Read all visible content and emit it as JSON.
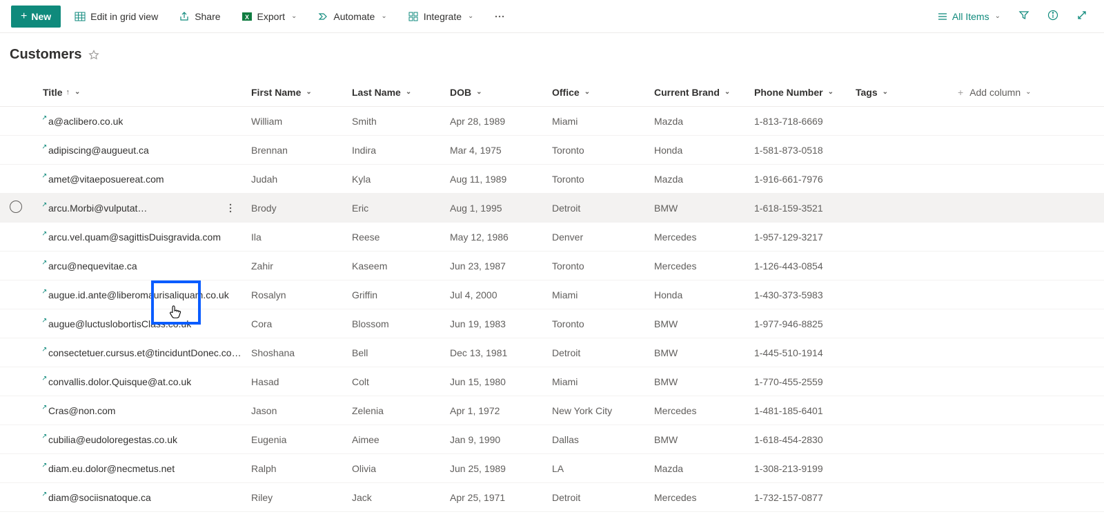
{
  "toolbar": {
    "new_label": "New",
    "edit_grid_label": "Edit in grid view",
    "share_label": "Share",
    "export_label": "Export",
    "automate_label": "Automate",
    "integrate_label": "Integrate",
    "view_label": "All Items"
  },
  "list": {
    "title": "Customers"
  },
  "columns": {
    "title": "Title",
    "first_name": "First Name",
    "last_name": "Last Name",
    "dob": "DOB",
    "office": "Office",
    "brand": "Current Brand",
    "phone": "Phone Number",
    "tags": "Tags",
    "add": "Add column"
  },
  "rows": [
    {
      "title": "a@aclibero.co.uk",
      "first": "William",
      "last": "Smith",
      "dob": "Apr 28, 1989",
      "office": "Miami",
      "brand": "Mazda",
      "phone": "1-813-718-6669"
    },
    {
      "title": "adipiscing@augueut.ca",
      "first": "Brennan",
      "last": "Indira",
      "dob": "Mar 4, 1975",
      "office": "Toronto",
      "brand": "Honda",
      "phone": "1-581-873-0518"
    },
    {
      "title": "amet@vitaeposuereat.com",
      "first": "Judah",
      "last": "Kyla",
      "dob": "Aug 11, 1989",
      "office": "Toronto",
      "brand": "Mazda",
      "phone": "1-916-661-7976"
    },
    {
      "title": "arcu.Morbi@vulputatedu...",
      "first": "Brody",
      "last": "Eric",
      "dob": "Aug 1, 1995",
      "office": "Detroit",
      "brand": "BMW",
      "phone": "1-618-159-3521",
      "hovered": true
    },
    {
      "title": "arcu.vel.quam@sagittisDuisgravida.com",
      "first": "Ila",
      "last": "Reese",
      "dob": "May 12, 1986",
      "office": "Denver",
      "brand": "Mercedes",
      "phone": "1-957-129-3217"
    },
    {
      "title": "arcu@nequevitae.ca",
      "first": "Zahir",
      "last": "Kaseem",
      "dob": "Jun 23, 1987",
      "office": "Toronto",
      "brand": "Mercedes",
      "phone": "1-126-443-0854"
    },
    {
      "title": "augue.id.ante@liberomaurisaliquam.co.uk",
      "first": "Rosalyn",
      "last": "Griffin",
      "dob": "Jul 4, 2000",
      "office": "Miami",
      "brand": "Honda",
      "phone": "1-430-373-5983"
    },
    {
      "title": "augue@luctuslobortisClass.co.uk",
      "first": "Cora",
      "last": "Blossom",
      "dob": "Jun 19, 1983",
      "office": "Toronto",
      "brand": "BMW",
      "phone": "1-977-946-8825"
    },
    {
      "title": "consectetuer.cursus.et@tinciduntDonec.co.uk",
      "first": "Shoshana",
      "last": "Bell",
      "dob": "Dec 13, 1981",
      "office": "Detroit",
      "brand": "BMW",
      "phone": "1-445-510-1914"
    },
    {
      "title": "convallis.dolor.Quisque@at.co.uk",
      "first": "Hasad",
      "last": "Colt",
      "dob": "Jun 15, 1980",
      "office": "Miami",
      "brand": "BMW",
      "phone": "1-770-455-2559"
    },
    {
      "title": "Cras@non.com",
      "first": "Jason",
      "last": "Zelenia",
      "dob": "Apr 1, 1972",
      "office": "New York City",
      "brand": "Mercedes",
      "phone": "1-481-185-6401"
    },
    {
      "title": "cubilia@eudoloregestas.co.uk",
      "first": "Eugenia",
      "last": "Aimee",
      "dob": "Jan 9, 1990",
      "office": "Dallas",
      "brand": "BMW",
      "phone": "1-618-454-2830"
    },
    {
      "title": "diam.eu.dolor@necmetus.net",
      "first": "Ralph",
      "last": "Olivia",
      "dob": "Jun 25, 1989",
      "office": "LA",
      "brand": "Mazda",
      "phone": "1-308-213-9199"
    },
    {
      "title": "diam@sociisnatoque.ca",
      "first": "Riley",
      "last": "Jack",
      "dob": "Apr 25, 1971",
      "office": "Detroit",
      "brand": "Mercedes",
      "phone": "1-732-157-0877"
    }
  ]
}
